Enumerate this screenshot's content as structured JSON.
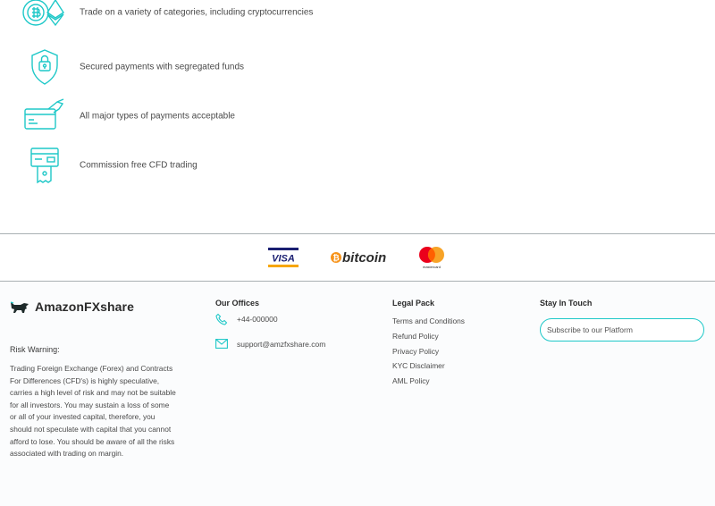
{
  "features": [
    {
      "icon": "crypto-coins-icon",
      "text": "Trade on a variety of categories, including cryptocurrencies"
    },
    {
      "icon": "shield-lock-icon",
      "text": "Secured payments with segregated funds"
    },
    {
      "icon": "card-payment-icon",
      "text": "All major types of payments acceptable"
    },
    {
      "icon": "receipt-card-icon",
      "text": "Commission free CFD trading"
    }
  ],
  "payments": {
    "visa": "VISA",
    "bitcoin": "bitcoin",
    "mastercard": "mastercard"
  },
  "footer": {
    "brand": "AmazonFXshare",
    "risk_title": "Risk Warning:",
    "risk_text": "Trading Foreign Exchange (Forex) and Contracts For Differences (CFD's) is highly speculative, carries a high level of risk and may not be suitable for all investors. You may sustain a loss of some or all of your invested capital, therefore, you should not speculate with capital that you cannot afford to lose. You should be aware of all the risks associated with trading on margin.",
    "offices_title": "Our Offices",
    "phone": "+44-000000",
    "email": "support@amzfxshare.com",
    "legal_title": "Legal Pack",
    "legal_links": [
      "Terms and Conditions",
      "Refund Policy",
      "Privacy Policy",
      "KYC Disclaimer",
      "AML Policy"
    ],
    "stay_title": "Stay In Touch",
    "subscribe_placeholder": "Subscribe to our Platform"
  },
  "colors": {
    "accent": "#1ec8c8",
    "visa_blue": "#1a1f71",
    "visa_gold": "#f7a600",
    "bitcoin_orange": "#f7931a",
    "mastercard_red": "#eb001b",
    "mastercard_yellow": "#f79e1b"
  }
}
